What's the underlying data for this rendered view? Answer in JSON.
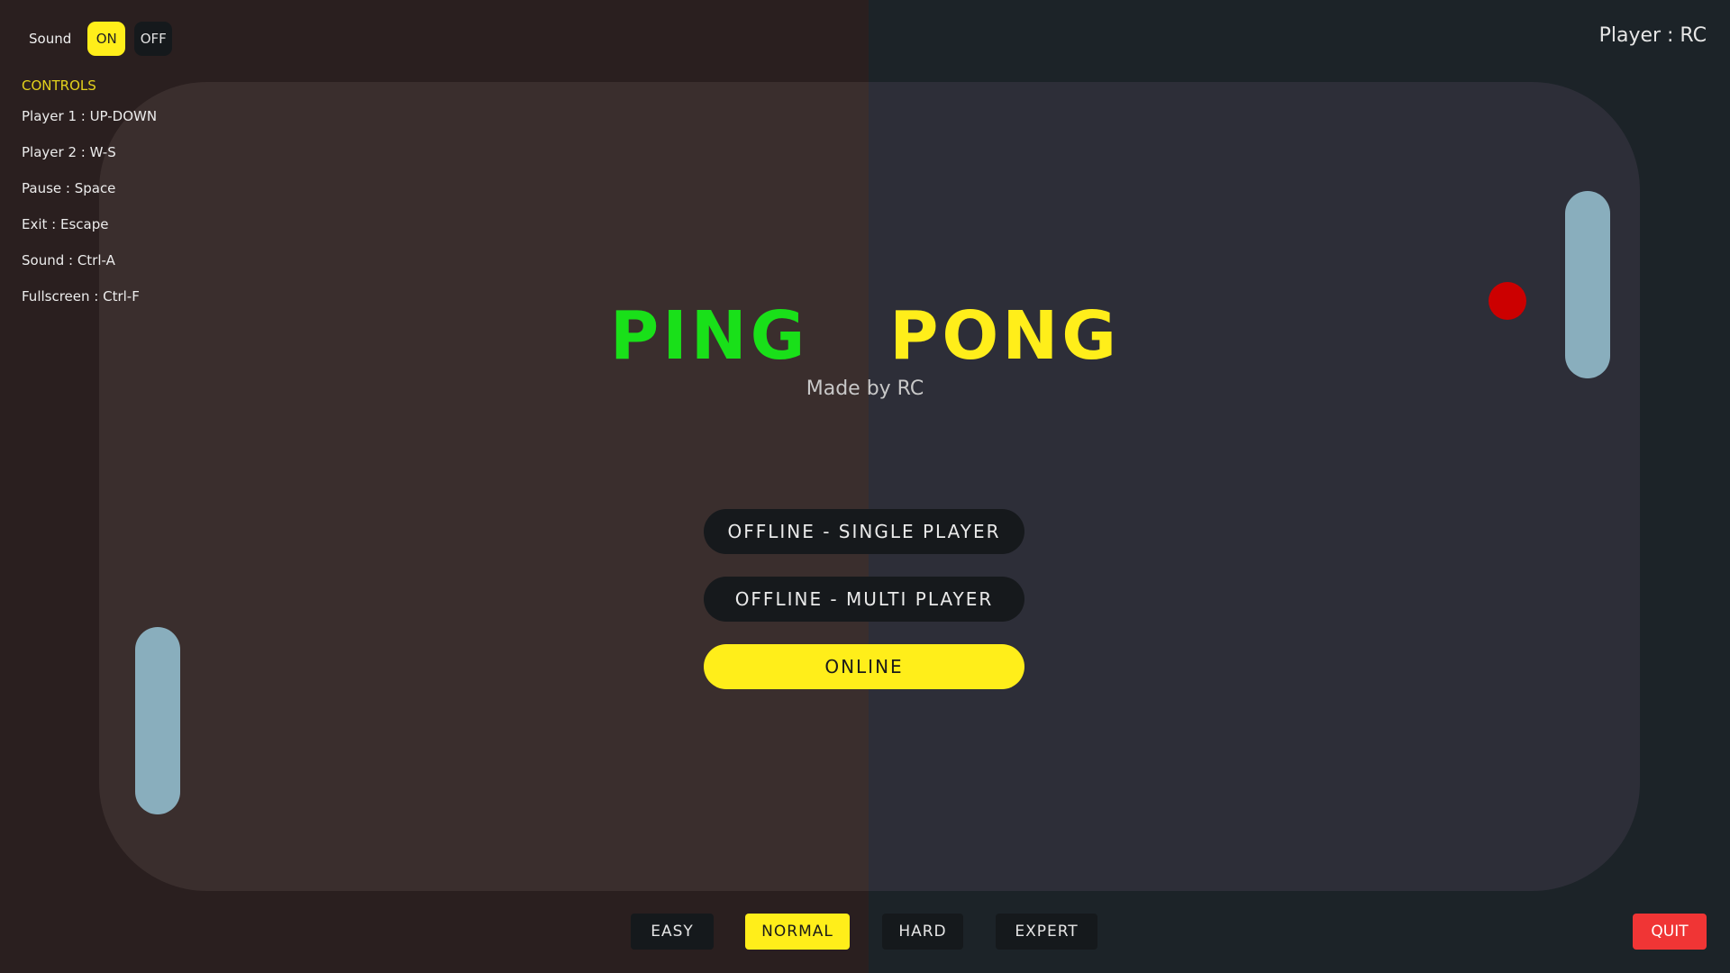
{
  "sound": {
    "label": "Sound",
    "on_label": "ON",
    "off_label": "OFF",
    "selected": "ON"
  },
  "controls": {
    "title": "CONTROLS",
    "items": [
      "Player 1 : UP-DOWN",
      "Player 2 : W-S",
      "Pause : Space",
      "Exit : Escape",
      "Sound : Ctrl-A",
      "Fullscreen : Ctrl-F"
    ]
  },
  "player": {
    "label": "Player : RC"
  },
  "title": {
    "ping": "PING",
    "pong": "PONG",
    "subtitle": "Made by RC"
  },
  "menu": {
    "items": [
      "OFFLINE - SINGLE PLAYER",
      "OFFLINE - MULTI PLAYER",
      "ONLINE"
    ],
    "selected": "ONLINE"
  },
  "difficulty": {
    "items": [
      "EASY",
      "NORMAL",
      "HARD",
      "EXPERT"
    ],
    "selected": "NORMAL"
  },
  "quit_label": "QUIT",
  "colors": {
    "accent_yellow": "#ffee1a",
    "ping_green": "#19e019",
    "ball_red": "#cc0000",
    "paddle": "#89aebd",
    "quit_red": "#f03535"
  }
}
